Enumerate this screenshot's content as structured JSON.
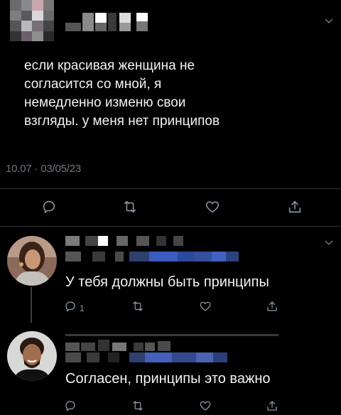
{
  "tweet": {
    "text": "если красивая женщина не\nсогласится со мной, я\nнемедленно изменю свои\nвзгляды. у меня нет принципов",
    "timestamp": "10.07 · 03/05/23",
    "actions": {
      "reply_icon": "reply-icon",
      "retweet_icon": "retweet-icon",
      "like_icon": "heart-icon",
      "share_icon": "share-icon"
    }
  },
  "replies": [
    {
      "text": "У тебя должны быть принципы",
      "reply_count": "1"
    },
    {
      "text": "Согласен, принципы это важно"
    }
  ],
  "colors": {
    "background": "#000000",
    "text": "#f2f2f2",
    "muted": "#6e767d",
    "divider": "#2f3336",
    "handle_blur": "#3b5bbf"
  }
}
